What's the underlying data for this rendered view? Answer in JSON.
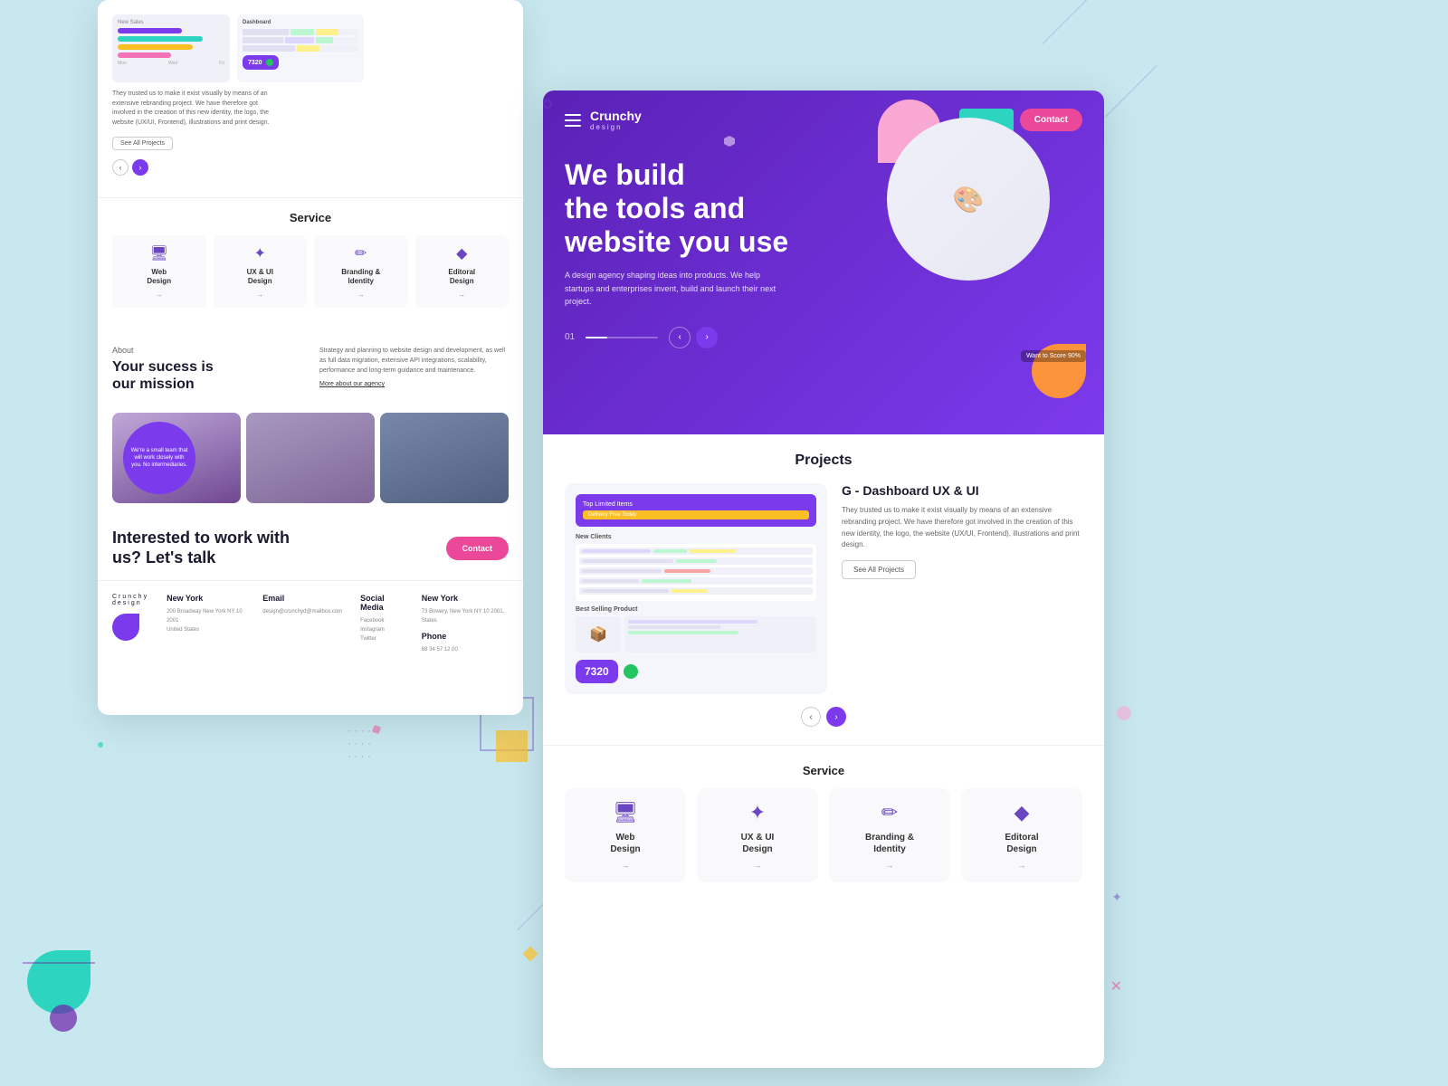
{
  "page": {
    "bg_color": "#c8e8f0"
  },
  "left_card": {
    "nav_arrows": [
      "‹",
      "›"
    ],
    "service_section": {
      "title": "Service",
      "services": [
        {
          "icon": "🖥",
          "name": "Web\nDesign",
          "arrow": "→"
        },
        {
          "icon": "✦",
          "name": "UX & UI\nDesign",
          "arrow": "→"
        },
        {
          "icon": "✏",
          "name": "Branding &\nIdentity",
          "arrow": "→"
        },
        {
          "icon": "◆",
          "name": "Editoral\nDesign",
          "arrow": "→"
        }
      ]
    },
    "about_section": {
      "label": "About",
      "title": "Your sucess is\nour mission",
      "body": "Strategy and planning to website design and development, as well as full data migration, extensive API integrations, scalability, performance and long-term guidance and maintenance.",
      "more_link": "More about our agency"
    },
    "team_circle_text": "We're a small team that will work closely with you. No intermediaries.",
    "cta": {
      "title": "Interested to work with\nus? Let's talk",
      "button_label": "Contact"
    },
    "footer": {
      "logo": "Crunchy",
      "logo_sub": "design",
      "columns": [
        {
          "heading": "New York",
          "lines": [
            "200 Broadway New York NY 10 2001",
            "United States"
          ]
        },
        {
          "heading": "Email",
          "lines": [
            "design@crunchyd@mailbox.com"
          ]
        },
        {
          "heading": "Social Media",
          "lines": [
            "Facebook",
            "Instagram",
            "Twitter"
          ]
        },
        {
          "heading": "New York",
          "lines": [
            "73 Bowery, New York NY 10 2001,",
            "States"
          ]
        },
        {
          "heading": "Phone",
          "lines": [
            "88 34 57 12 00"
          ]
        }
      ]
    }
  },
  "right_card": {
    "hero": {
      "brand": "Crunchy",
      "brand_sub": "design",
      "contact_btn": "Contact",
      "title": "We build\nthe tools and\nwebsite you use",
      "body": "A design agency shaping ideas into products. We help startups and enterprises invent, build and launch their next project.",
      "slide_num": "01",
      "want_score": "Want to Score 90%"
    },
    "projects": {
      "title": "Projects",
      "project_name": "G - Dashboard UX & UI",
      "project_desc": "They trusted us to make it exist visually by means of an extensive rebranding project. We have therefore got involved in the creation of this new identity, the logo, the website (UX/UI, Frontend), illustrations and print design.",
      "see_all_btn": "See All Projects",
      "dashboard_label": "Top Limited Items",
      "delivery_label": "Delivery Free Today",
      "new_clients_label": "New Clients",
      "best_selling_label": "Best Selling Product",
      "stat_number": "7320"
    },
    "service_section": {
      "title": "Service",
      "services": [
        {
          "icon": "🖥",
          "name": "Web\nDesign",
          "arrow": "→"
        },
        {
          "icon": "✦",
          "name": "UX & UI\nDesign",
          "arrow": "→"
        },
        {
          "icon": "✏",
          "name": "Branding &\nIdentity",
          "arrow": "→"
        },
        {
          "icon": "◆",
          "name": "Editoral\nDesign",
          "arrow": "→"
        }
      ]
    }
  }
}
